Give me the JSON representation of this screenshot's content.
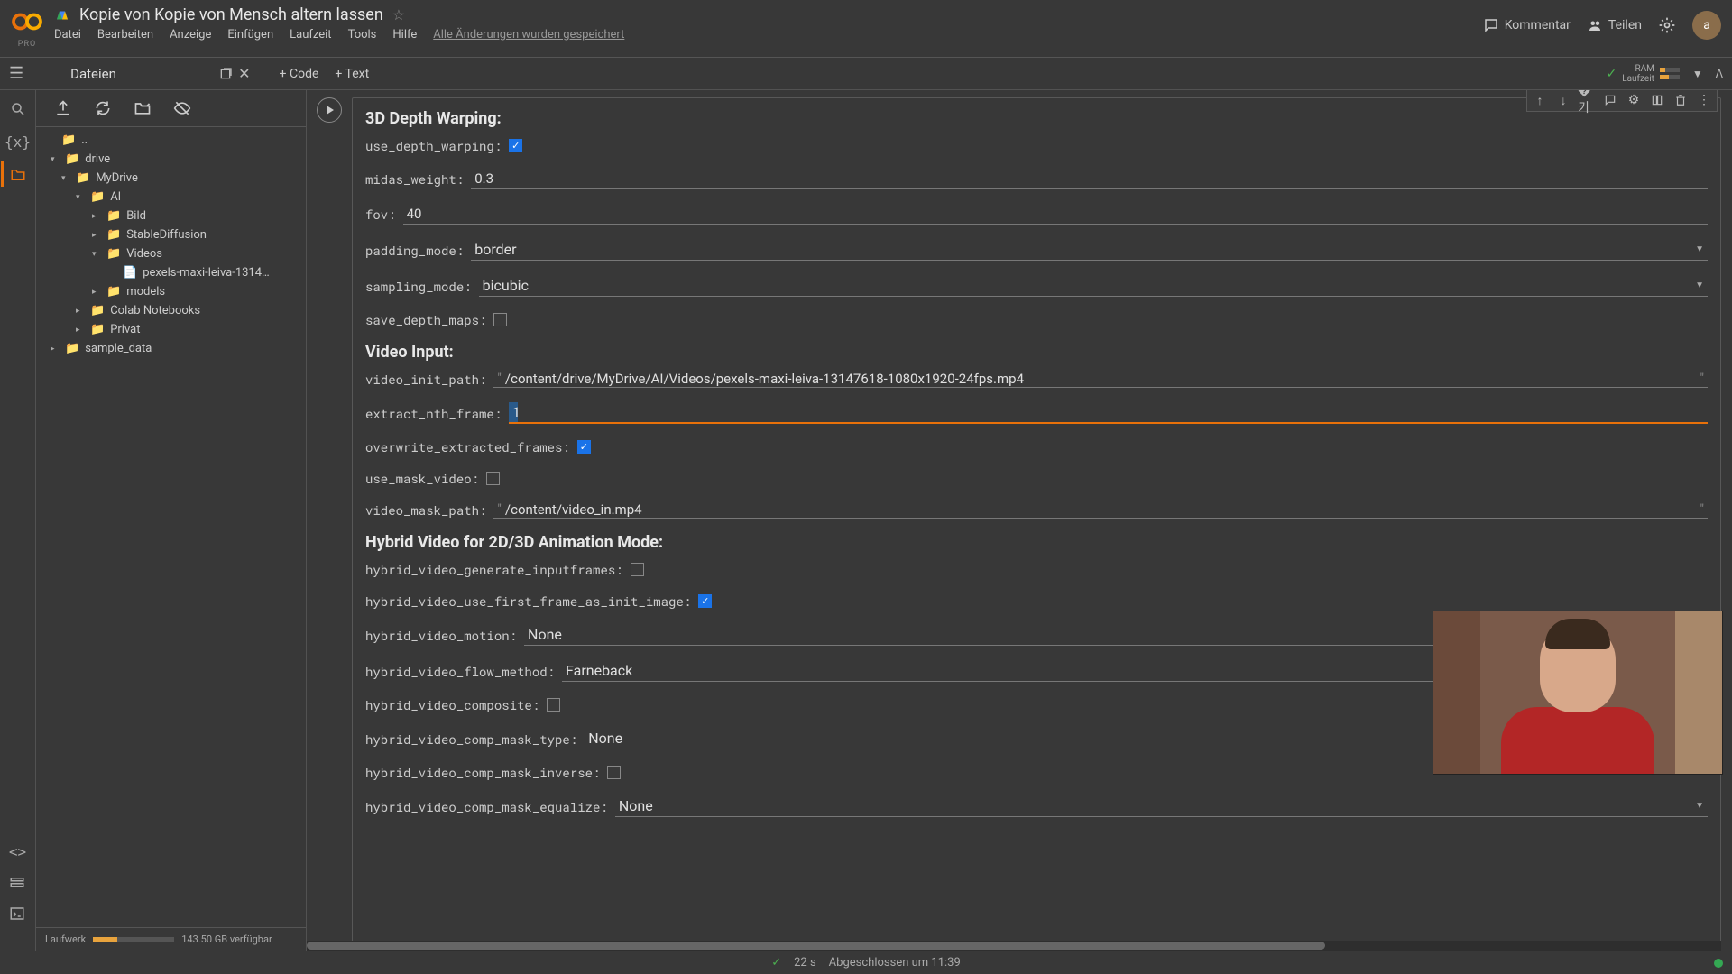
{
  "header": {
    "pro": "PRO",
    "title": "Kopie von Kopie von Mensch altern lassen",
    "menu": [
      "Datei",
      "Bearbeiten",
      "Anzeige",
      "Einfügen",
      "Laufzeit",
      "Tools",
      "Hilfe"
    ],
    "save_status": "Alle Änderungen wurden gespeichert",
    "comment": "Kommentar",
    "share": "Teilen",
    "avatar": "a"
  },
  "toolbar": {
    "files_title": "Dateien",
    "add_code": "Code",
    "add_text": "Text",
    "ram": "RAM",
    "runtime": "Laufzeit"
  },
  "tree": {
    "up": "..",
    "drive": "drive",
    "mydrive": "MyDrive",
    "ai": "AI",
    "bild": "Bild",
    "sd": "StableDiffusion",
    "videos": "Videos",
    "vfile": "pexels-maxi-leiva-1314…",
    "models": "models",
    "colab": "Colab Notebooks",
    "privat": "Privat",
    "sample": "sample_data"
  },
  "disk": {
    "label": "Laufwerk",
    "free": "143.50 GB verfügbar"
  },
  "sections": {
    "depth": "3D Depth Warping:",
    "video": "Video Input:",
    "hybrid": "Hybrid Video for 2D/3D Animation Mode:"
  },
  "labels": {
    "use_depth_warping": "use_depth_warping:",
    "midas_weight": "midas_weight:",
    "fov": "fov:",
    "padding_mode": "padding_mode:",
    "sampling_mode": "sampling_mode:",
    "save_depth_maps": "save_depth_maps:",
    "video_init_path": "video_init_path:",
    "extract_nth_frame": "extract_nth_frame:",
    "overwrite_extracted_frames": "overwrite_extracted_frames:",
    "use_mask_video": "use_mask_video:",
    "video_mask_path": "video_mask_path:",
    "hv_gen_inputframes": "hybrid_video_generate_inputframes:",
    "hv_first_frame": "hybrid_video_use_first_frame_as_init_image:",
    "hv_motion": "hybrid_video_motion:",
    "hv_flow_method": "hybrid_video_flow_method:",
    "hv_composite": "hybrid_video_composite:",
    "hv_mask_type": "hybrid_video_comp_mask_type:",
    "hv_mask_inverse": "hybrid_video_comp_mask_inverse:",
    "hv_mask_equalize": "hybrid_video_comp_mask_equalize:"
  },
  "values": {
    "midas_weight": "0.3",
    "fov": "40",
    "padding_mode": "border",
    "sampling_mode": "bicubic",
    "video_init_path": "/content/drive/MyDrive/AI/Videos/pexels-maxi-leiva-13147618-1080x1920-24fps.mp4",
    "extract_nth_frame": "1",
    "video_mask_path": "/content/video_in.mp4",
    "hv_motion": "None",
    "hv_flow_method": "Farneback",
    "hv_mask_type": "None",
    "hv_mask_equalize": "None"
  },
  "footer": {
    "duration": "22 s",
    "done": "Abgeschlossen um 11:39"
  }
}
